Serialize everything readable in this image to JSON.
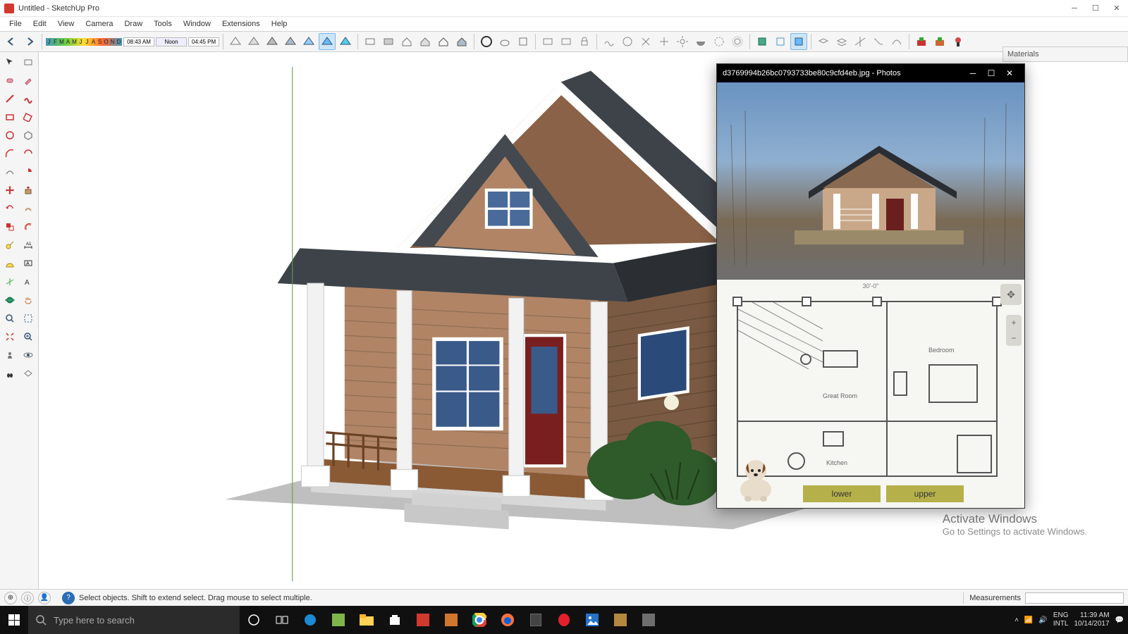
{
  "title": "Untitled - SketchUp Pro",
  "menu": [
    "File",
    "Edit",
    "View",
    "Camera",
    "Draw",
    "Tools",
    "Window",
    "Extensions",
    "Help"
  ],
  "months": [
    "J",
    "F",
    "M",
    "A",
    "M",
    "J",
    "J",
    "A",
    "S",
    "O",
    "N",
    "D"
  ],
  "time_am": "08:43 AM",
  "time_noon": "Noon",
  "time_pm": "04:45 PM",
  "materials_label": "Materials",
  "photos_title": "d3769994b26bc0793733be80c9cfd4eb.jpg - Photos",
  "floorplan": {
    "dimension_top": "30'-0\"",
    "room1": "Great Room",
    "room2": "Bedroom",
    "room3": "Kitchen",
    "btn_lower": "lower",
    "btn_upper": "upper"
  },
  "status_hint": "Select objects. Shift to extend select. Drag mouse to select multiple.",
  "measure_label": "Measurements",
  "watermark_title": "Activate Windows",
  "watermark_sub": "Go to Settings to activate Windows.",
  "search_placeholder": "Type here to search",
  "tray": {
    "lang1": "ENG",
    "lang2": "INTL",
    "time": "11:39 AM",
    "date": "10/14/2017"
  }
}
